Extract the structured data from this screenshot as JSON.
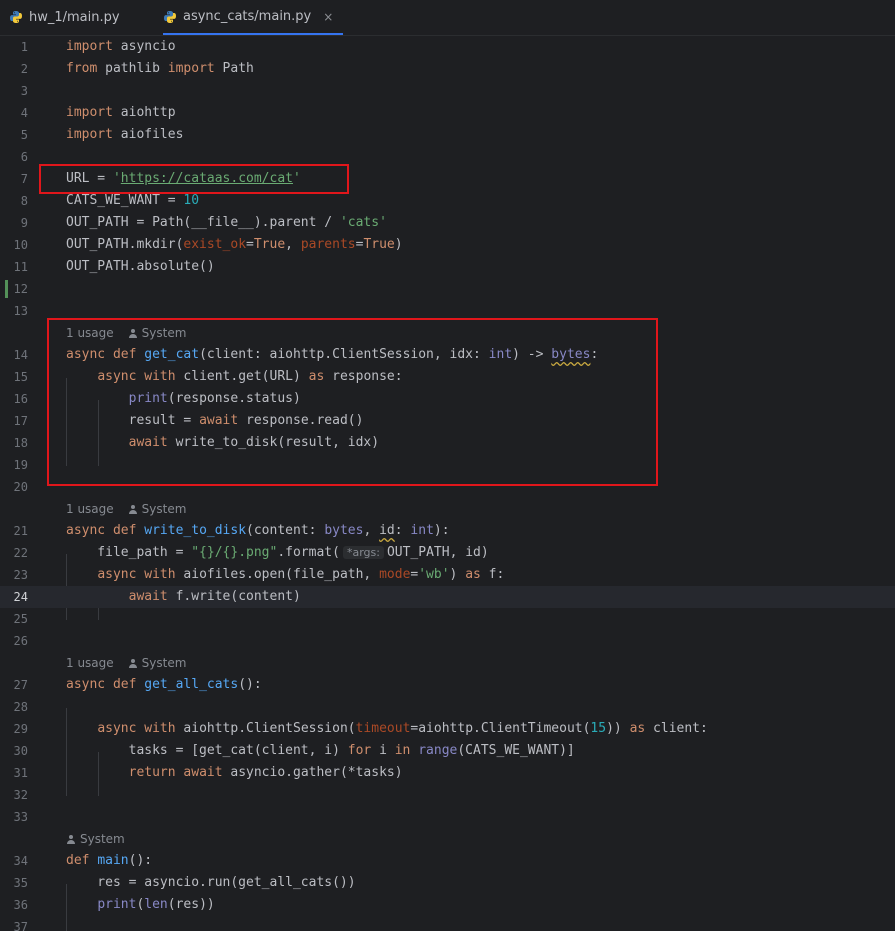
{
  "tabs": [
    {
      "label": "hw_1/main.py",
      "active": false
    },
    {
      "label": "async_cats/main.py",
      "active": true,
      "close": "×"
    }
  ],
  "lines": {
    "l1": "import asyncio",
    "l2": "from pathlib import Path",
    "l4": "import aiohttp",
    "l5": "import aiofiles",
    "l7": "URL = 'https://cataas.com/cat'",
    "l8": "CATS_WE_WANT = 10",
    "l9": "OUT_PATH = Path(__file__).parent / 'cats'",
    "l10": "OUT_PATH.mkdir(exist_ok=True, parents=True)",
    "l11": "OUT_PATH.absolute()",
    "l14": "async def get_cat(client: aiohttp.ClientSession, idx: int) -> bytes:",
    "l15": "async with client.get(URL) as response:",
    "l16": "print(response.status)",
    "l17": "result = await response.read()",
    "l18": "await write_to_disk(result, idx)",
    "l21": "async def write_to_disk(content: bytes, id: int):",
    "l22": "file_path = \"{}/{}.png\".format(*args: OUT_PATH, id)",
    "l23": "async with aiofiles.open(file_path, mode='wb') as f:",
    "l24": "await f.write(content)",
    "l27": "async def get_all_cats():",
    "l29": "async with aiohttp.ClientSession(timeout=aiohttp.ClientTimeout(15)) as client:",
    "l30": "tasks = [get_cat(client, i) for i in range(CATS_WE_WANT)]",
    "l31": "return await asyncio.gather(*tasks)",
    "l34": "def main():",
    "l35": "res = asyncio.run(get_all_cats())",
    "l36": "print(len(res))"
  },
  "hints": {
    "usage": "1 usage",
    "author": "System",
    "args_inlay": "*args:"
  },
  "line_numbers": [
    "1",
    "2",
    "3",
    "4",
    "5",
    "6",
    "7",
    "8",
    "9",
    "10",
    "11",
    "12",
    "13",
    "14",
    "15",
    "16",
    "17",
    "18",
    "19",
    "20",
    "21",
    "22",
    "23",
    "24",
    "25",
    "26",
    "27",
    "28",
    "29",
    "30",
    "31",
    "32",
    "33",
    "34",
    "35",
    "36",
    "37"
  ],
  "current_line": "24",
  "colors": {
    "background": "#1e1f22",
    "keyword": "#cf8e6d",
    "function": "#56a8f5",
    "string": "#6aab73",
    "number": "#2aacb8",
    "annotation_box": "#e0161b"
  },
  "icons": {
    "tab": "python-icon",
    "author": "person-icon",
    "close": "close-icon"
  }
}
